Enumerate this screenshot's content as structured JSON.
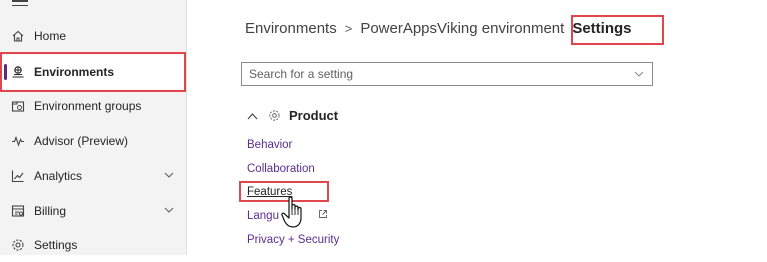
{
  "sidebar": {
    "items": [
      {
        "label": "Home",
        "icon": "home-icon"
      },
      {
        "label": "Environments",
        "icon": "environment-icon",
        "active": true
      },
      {
        "label": "Environment groups",
        "icon": "environment-groups-icon"
      },
      {
        "label": "Advisor (Preview)",
        "icon": "pulse-icon"
      },
      {
        "label": "Analytics",
        "icon": "chart-icon",
        "expandable": true
      },
      {
        "label": "Billing",
        "icon": "billing-icon",
        "expandable": true
      },
      {
        "label": "Settings",
        "icon": "gear-icon"
      }
    ]
  },
  "breadcrumb": {
    "root": "Environments",
    "separator": ">",
    "environment": "PowerAppsViking environment",
    "current": "Settings"
  },
  "search": {
    "placeholder": "Search for a setting"
  },
  "section": {
    "title": "Product",
    "links": [
      "Behavior",
      "Collaboration",
      "Features",
      "Langu",
      "Privacy + Security"
    ]
  },
  "colors": {
    "accent": "#5c2d91",
    "highlight": "#e0474c",
    "active_bar": "#5b2a86"
  }
}
